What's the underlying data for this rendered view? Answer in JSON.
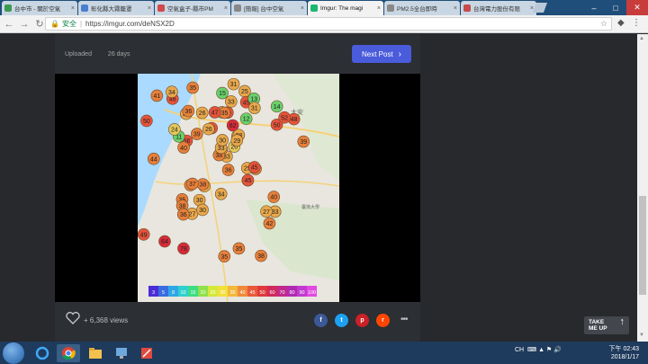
{
  "browser": {
    "tabs": [
      {
        "label": "台中市 - 關於空氣",
        "color": "#3a9a52"
      },
      {
        "label": "彰化縣大霧籠罩",
        "color": "#4a7fd0"
      },
      {
        "label": "空氣盒子-縣市PM",
        "color": "#d04a4a"
      },
      {
        "label": "[簡報] 台中空氣",
        "color": "#888888"
      },
      {
        "label": "Imgur: The magi",
        "color": "#1bb76e"
      },
      {
        "label": "PM2.5全台即時",
        "color": "#888888"
      },
      {
        "label": "台灣電力股份有限",
        "color": "#c84a4a"
      }
    ],
    "active_tab": 4,
    "secure_label": "安全",
    "url": "https://imgur.com/deNSX2D"
  },
  "post": {
    "uploaded_label": "Uploaded",
    "uploaded_ago": "26 days",
    "next_label": "Next Post",
    "views_label": "+ 6,368 views",
    "take_me_up": "TAKE ME UP"
  },
  "map": {
    "labels": [
      "大安",
      "大雅",
      "臺灣大學"
    ],
    "legend": [
      "3",
      "5",
      "8",
      "10",
      "15",
      "20",
      "25",
      "30",
      "35",
      "40",
      "45",
      "50",
      "60",
      "70",
      "80",
      "90",
      "100"
    ],
    "dots": [
      {
        "v": "33"
      },
      {
        "v": "28"
      },
      {
        "v": "33"
      },
      {
        "v": "35"
      },
      {
        "v": "30"
      },
      {
        "v": "32"
      },
      {
        "v": "25"
      },
      {
        "v": "50"
      },
      {
        "v": "45"
      },
      {
        "v": "20"
      },
      {
        "v": "35"
      },
      {
        "v": "33"
      },
      {
        "v": "56"
      },
      {
        "v": "14"
      },
      {
        "v": "38"
      },
      {
        "v": "12"
      },
      {
        "v": "27"
      },
      {
        "v": "31"
      },
      {
        "v": "62"
      },
      {
        "v": "41"
      },
      {
        "v": "45"
      },
      {
        "v": "38"
      },
      {
        "v": "30"
      },
      {
        "v": "35"
      },
      {
        "v": "28"
      },
      {
        "v": "43"
      },
      {
        "v": "36"
      },
      {
        "v": "15"
      },
      {
        "v": "11"
      },
      {
        "v": "29"
      },
      {
        "v": "50"
      },
      {
        "v": "33"
      },
      {
        "v": "34"
      },
      {
        "v": "30"
      },
      {
        "v": "26"
      },
      {
        "v": "13"
      },
      {
        "v": "38"
      },
      {
        "v": "27"
      },
      {
        "v": "40"
      },
      {
        "v": "45"
      },
      {
        "v": "31"
      },
      {
        "v": "26"
      },
      {
        "v": "39"
      },
      {
        "v": "32"
      },
      {
        "v": "30"
      },
      {
        "v": "24"
      },
      {
        "v": "29"
      },
      {
        "v": "36"
      },
      {
        "v": "35"
      },
      {
        "v": "45"
      },
      {
        "v": "64"
      },
      {
        "v": "39"
      },
      {
        "v": "50"
      },
      {
        "v": "42"
      },
      {
        "v": "38"
      },
      {
        "v": "78"
      },
      {
        "v": "46"
      },
      {
        "v": "41"
      },
      {
        "v": "35"
      },
      {
        "v": "48"
      },
      {
        "v": "33"
      },
      {
        "v": "37"
      },
      {
        "v": "44"
      },
      {
        "v": "40"
      },
      {
        "v": "52"
      },
      {
        "v": "34"
      },
      {
        "v": "31"
      },
      {
        "v": "47"
      },
      {
        "v": "36"
      },
      {
        "v": "49"
      }
    ]
  },
  "taskbar": {
    "time": "下午 02:43",
    "date": "2018/1/17",
    "tray": "CH"
  },
  "colors": {
    "accent": "#4a5bdc",
    "bg": "#27292d"
  }
}
